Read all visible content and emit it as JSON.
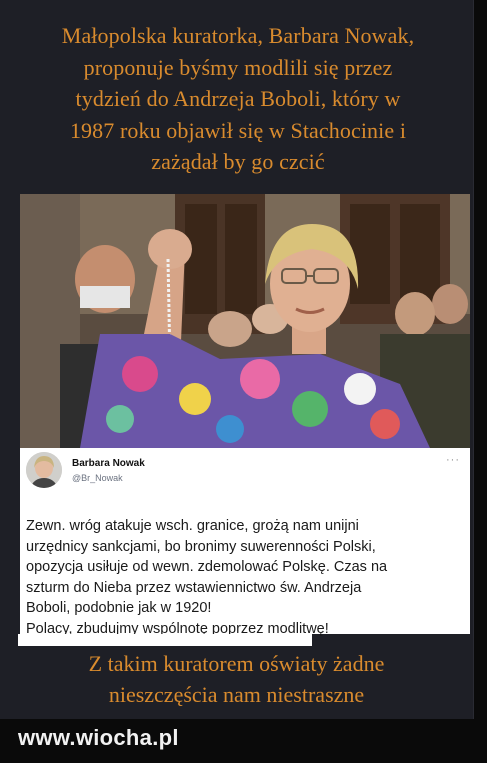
{
  "headline": {
    "lines": [
      "Małopolska kuratorka, Barbara Nowak,",
      "proponuje byśmy modlili się przez",
      "tydzień do Andrzeja Boboli, który w",
      "1987 roku objawił się w Stachocinie i",
      "zażądał by go czcić"
    ]
  },
  "tweet": {
    "author_name": "Barbara Nowak",
    "handle": "@Br_Nowak",
    "menu_icon": "more-dots-icon",
    "lines": [
      "Zewn. wróg atakuje wsch. granice, grożą nam unijni",
      "urzędnicy sankcjami, bo bronimy suwerenności Polski,",
      "opozycja usiłuje od wewn. zdemolować Polskę. Czas na",
      "szturm do Nieba przez wstawiennictwo św. Andrzeja",
      "Boboli, podobnie jak w 1920!",
      "Polacy, zbudujmy wspólnotę poprzez modlitwę!"
    ]
  },
  "caption": {
    "lines": [
      "Z takim kuratorem oświaty żadne",
      "nieszczęścia nam niestraszne"
    ]
  },
  "watermark": "www.wiocha.pl",
  "colors": {
    "headline": "#d98b2e",
    "background": "#1e1f26"
  }
}
